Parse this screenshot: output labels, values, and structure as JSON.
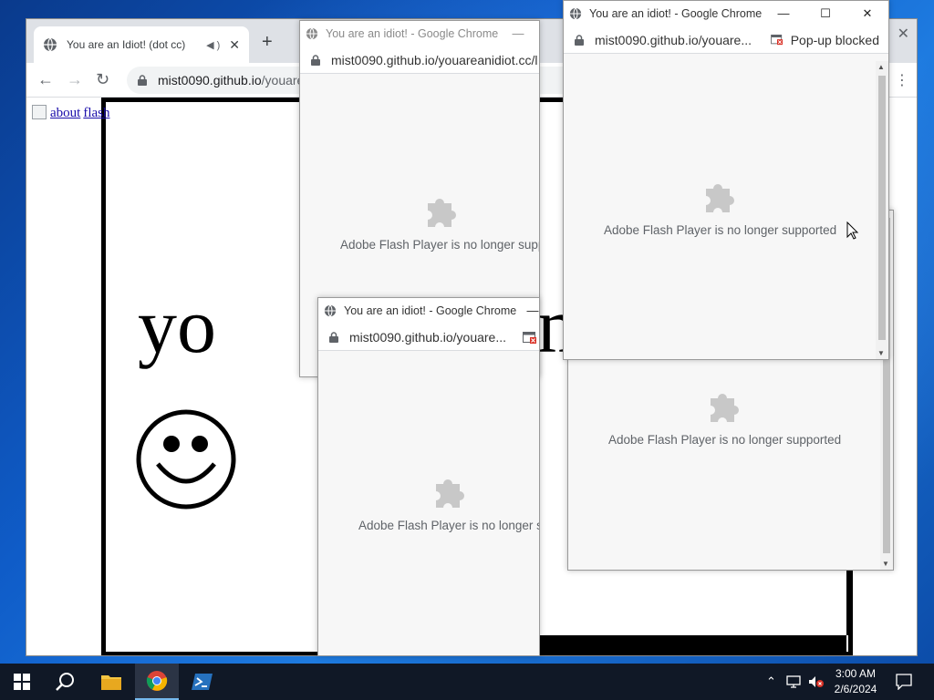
{
  "main_window": {
    "tab_title": "You are an Idiot! (dot cc)",
    "new_tab_symbol": "+",
    "url_host": "mist0090.github.io",
    "url_path": "/youare",
    "page_links": [
      "about",
      "flash"
    ],
    "page_big_text": "yo",
    "page_big_text_right": "m"
  },
  "popups": [
    {
      "title": "You are an idiot! - Google Chrome",
      "url_host": "mist0090.github.io",
      "url_path": "/youareanidiot.cc/l",
      "message": "Adobe Flash Player is no longer supp"
    },
    {
      "title": "You are an idiot! - Google Chrome",
      "url_host": "mist0090.github.io",
      "url_path": "/youare...",
      "message": "Adobe Flash Player is no longer s"
    },
    {
      "message": "Adobe Flash Player is no longer supported"
    },
    {
      "title": "You are an idiot! - Google Chrome",
      "url_host": "mist0090.github.io",
      "url_path": "/youare...",
      "blocked_label": "Pop-up blocked",
      "message": "Adobe Flash Player is no longer supported"
    }
  ],
  "taskbar": {
    "time": "3:00 AM",
    "date": "2/6/2024",
    "pinned": [
      "windows-start-icon",
      "search-icon",
      "file-explorer-icon",
      "chrome-icon",
      "powershell-icon"
    ]
  },
  "colors": {
    "desktop": "#0f5cc8",
    "taskbar": "#101826",
    "link": "#1a0dab",
    "plugin_gray": "#c8c8c8"
  }
}
